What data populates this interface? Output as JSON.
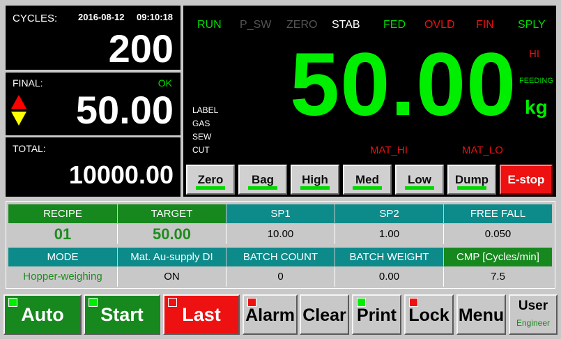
{
  "cycles": {
    "label": "CYCLES:",
    "date": "2016-08-12",
    "time": "09:10:18",
    "value": "200"
  },
  "final": {
    "label": "FINAL:",
    "status": "OK",
    "value": "50.00"
  },
  "total": {
    "label": "TOTAL:",
    "value": "10000.00"
  },
  "status_flags": [
    {
      "label": "RUN",
      "color": "#00dd00"
    },
    {
      "label": "P_SW",
      "color": "#555555"
    },
    {
      "label": "ZERO",
      "color": "#555555"
    },
    {
      "label": "STAB",
      "color": "#ffffff"
    },
    {
      "label": "FED",
      "color": "#00dd00"
    },
    {
      "label": "OVLD",
      "color": "#ee1111"
    },
    {
      "label": "FIN",
      "color": "#ee1111"
    },
    {
      "label": "SPLY",
      "color": "#00dd00"
    }
  ],
  "display": {
    "weight": "50.00",
    "unit": "kg",
    "hi": "HI",
    "feeding": "FEEDING",
    "outputs": [
      "LABEL",
      "GAS",
      "SEW",
      "CUT"
    ],
    "mat_hi": "MAT_HI",
    "mat_lo": "MAT_LO",
    "weight_color": "#00ee00"
  },
  "function_buttons": [
    "Zero",
    "Bag",
    "High",
    "Med",
    "Low",
    "Dump"
  ],
  "estop": "E-stop",
  "table": {
    "row1_headers": [
      "RECIPE",
      "TARGET",
      "SP1",
      "SP2",
      "FREE FALL"
    ],
    "row1_values": [
      "01",
      "50.00",
      "10.00",
      "1.00",
      "0.050"
    ],
    "row2_headers": [
      "MODE",
      "Mat. Au-supply DI",
      "BATCH COUNT",
      "BATCH WEIGHT",
      "CMP [Cycles/min]"
    ],
    "row2_values": [
      "Hopper-weighing",
      "ON",
      "0",
      "0.00",
      "7.5"
    ]
  },
  "bottom": {
    "auto": "Auto",
    "start": "Start",
    "last": "Last",
    "alarm": "Alarm",
    "clear": "Clear",
    "print": "Print",
    "lock": "Lock",
    "menu": "Menu",
    "user": "User",
    "user_role": "Engineer"
  }
}
